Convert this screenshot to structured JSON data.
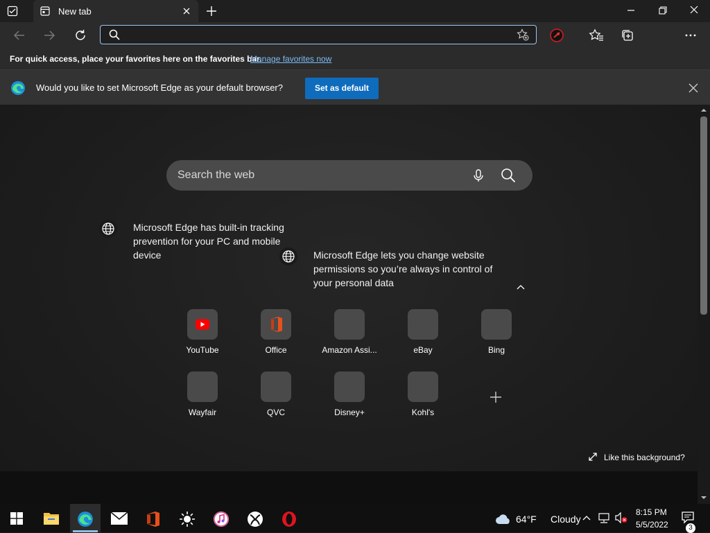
{
  "tab": {
    "title": "New tab"
  },
  "address_bar": {
    "value": "",
    "placeholder": ""
  },
  "favorites_bar": {
    "message": "For quick access, place your favorites here on the favorites bar.",
    "link": "Manage favorites now"
  },
  "infobar": {
    "message": "Would you like to set Microsoft Edge as your default browser?",
    "button": "Set as default"
  },
  "search": {
    "placeholder": "Search the web"
  },
  "tips": [
    {
      "text": "Microsoft Edge has built-in tracking prevention for your PC and mobile device"
    },
    {
      "text": "Microsoft Edge lets you change website permissions so you’re always in control of your personal data"
    }
  ],
  "quick_links": [
    {
      "label": "YouTube",
      "icon": "youtube-icon"
    },
    {
      "label": "Office",
      "icon": "office-icon"
    },
    {
      "label": "Amazon Assi...",
      "icon": ""
    },
    {
      "label": "eBay",
      "icon": ""
    },
    {
      "label": "Bing",
      "icon": ""
    },
    {
      "label": "Wayfair",
      "icon": ""
    },
    {
      "label": "QVC",
      "icon": ""
    },
    {
      "label": "Disney+",
      "icon": ""
    },
    {
      "label": "Kohl's",
      "icon": ""
    }
  ],
  "background_prompt": "Like this background?",
  "taskbar": {
    "apps": [
      "windows-start",
      "file-explorer",
      "microsoft-edge",
      "mail",
      "office",
      "brightness",
      "itunes",
      "xbox",
      "opera"
    ],
    "weather": {
      "temp": "64°F",
      "condition": "Cloudy"
    },
    "clock": {
      "time": "8:15 PM",
      "date": "5/5/2022"
    },
    "notifications": "3"
  },
  "colors": {
    "accent": "#0f6cbd",
    "link": "#7fbbf5",
    "address_focus": "#9fc7ee",
    "background": "#1c1c1c"
  }
}
